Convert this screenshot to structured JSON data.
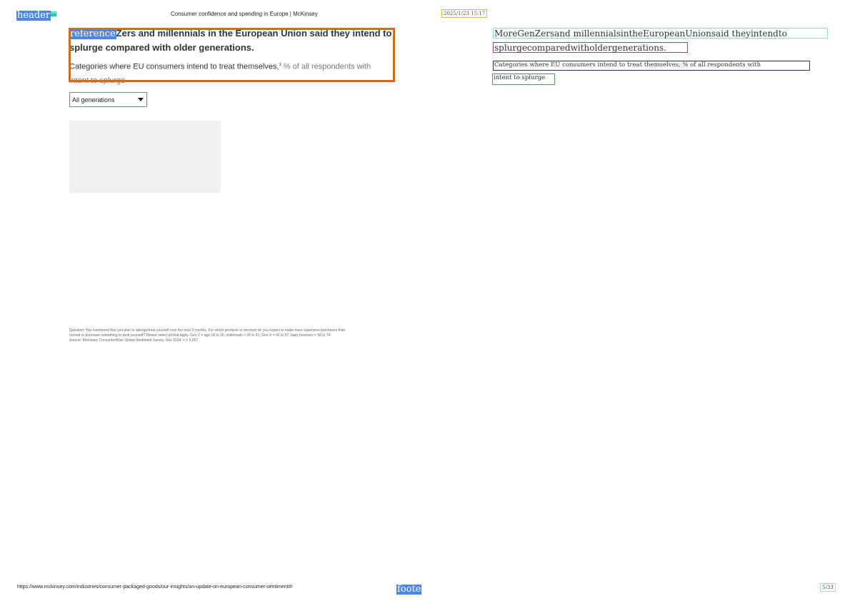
{
  "labels": {
    "header_tag": "header",
    "header_badge": "•••",
    "reference_tag": "reference",
    "footer_tag": "foote"
  },
  "page": {
    "title": "Consumer confidence and spending in Europe | McKinsey",
    "timestamp": "2025/1/23 15:17",
    "url": "https://www.mckinsey.com/industries/consumer-packaged-goods/our-insights/an-update-on-european-consumer-sentiment#/",
    "page_number": "5/33"
  },
  "article": {
    "heading_rest": "Zers and millennials in the European Union said they intend to",
    "heading_line2": "splurge compared with older generations.",
    "subtitle_main": "Categories where EU consumers intend to treat themselves,",
    "subtitle_sup": "1",
    "subtitle_unit": " % of all respondents with",
    "subtitle_line2": "intent to splurge",
    "dropdown_value": "All generations",
    "footnote_line1": "Question: You mentioned that you plan to splurge/treat yourself over the next 3 months. For which products or services do you expect to make more expensive purchases than",
    "footnote_line2": "normal or purchase something to treat yourself? Please select all that apply. Gen Z = age 18 to 26; millennials = 26 to 41; Gen X = 42 to 57; baby boomers = 58 to 74.",
    "footnote_line3": "Source: McKinsey ConsumerWise Global Sentiment Survey, Nov 2024, n = 5,057"
  },
  "ocr": {
    "line1": "MoreGenZersand millennialsintheEuropeanUnionsaid theyintendto",
    "line2": "splurgecomparedwitholdergenerations.",
    "line3": "Categories where EU consumers intend to treat themselves, % of all respondents with",
    "line4": "intent to splurge"
  },
  "colors": {
    "tag_blue": "#4a86e8",
    "frame_orange": "#d2691e",
    "badge_green": "#22d3a2"
  }
}
